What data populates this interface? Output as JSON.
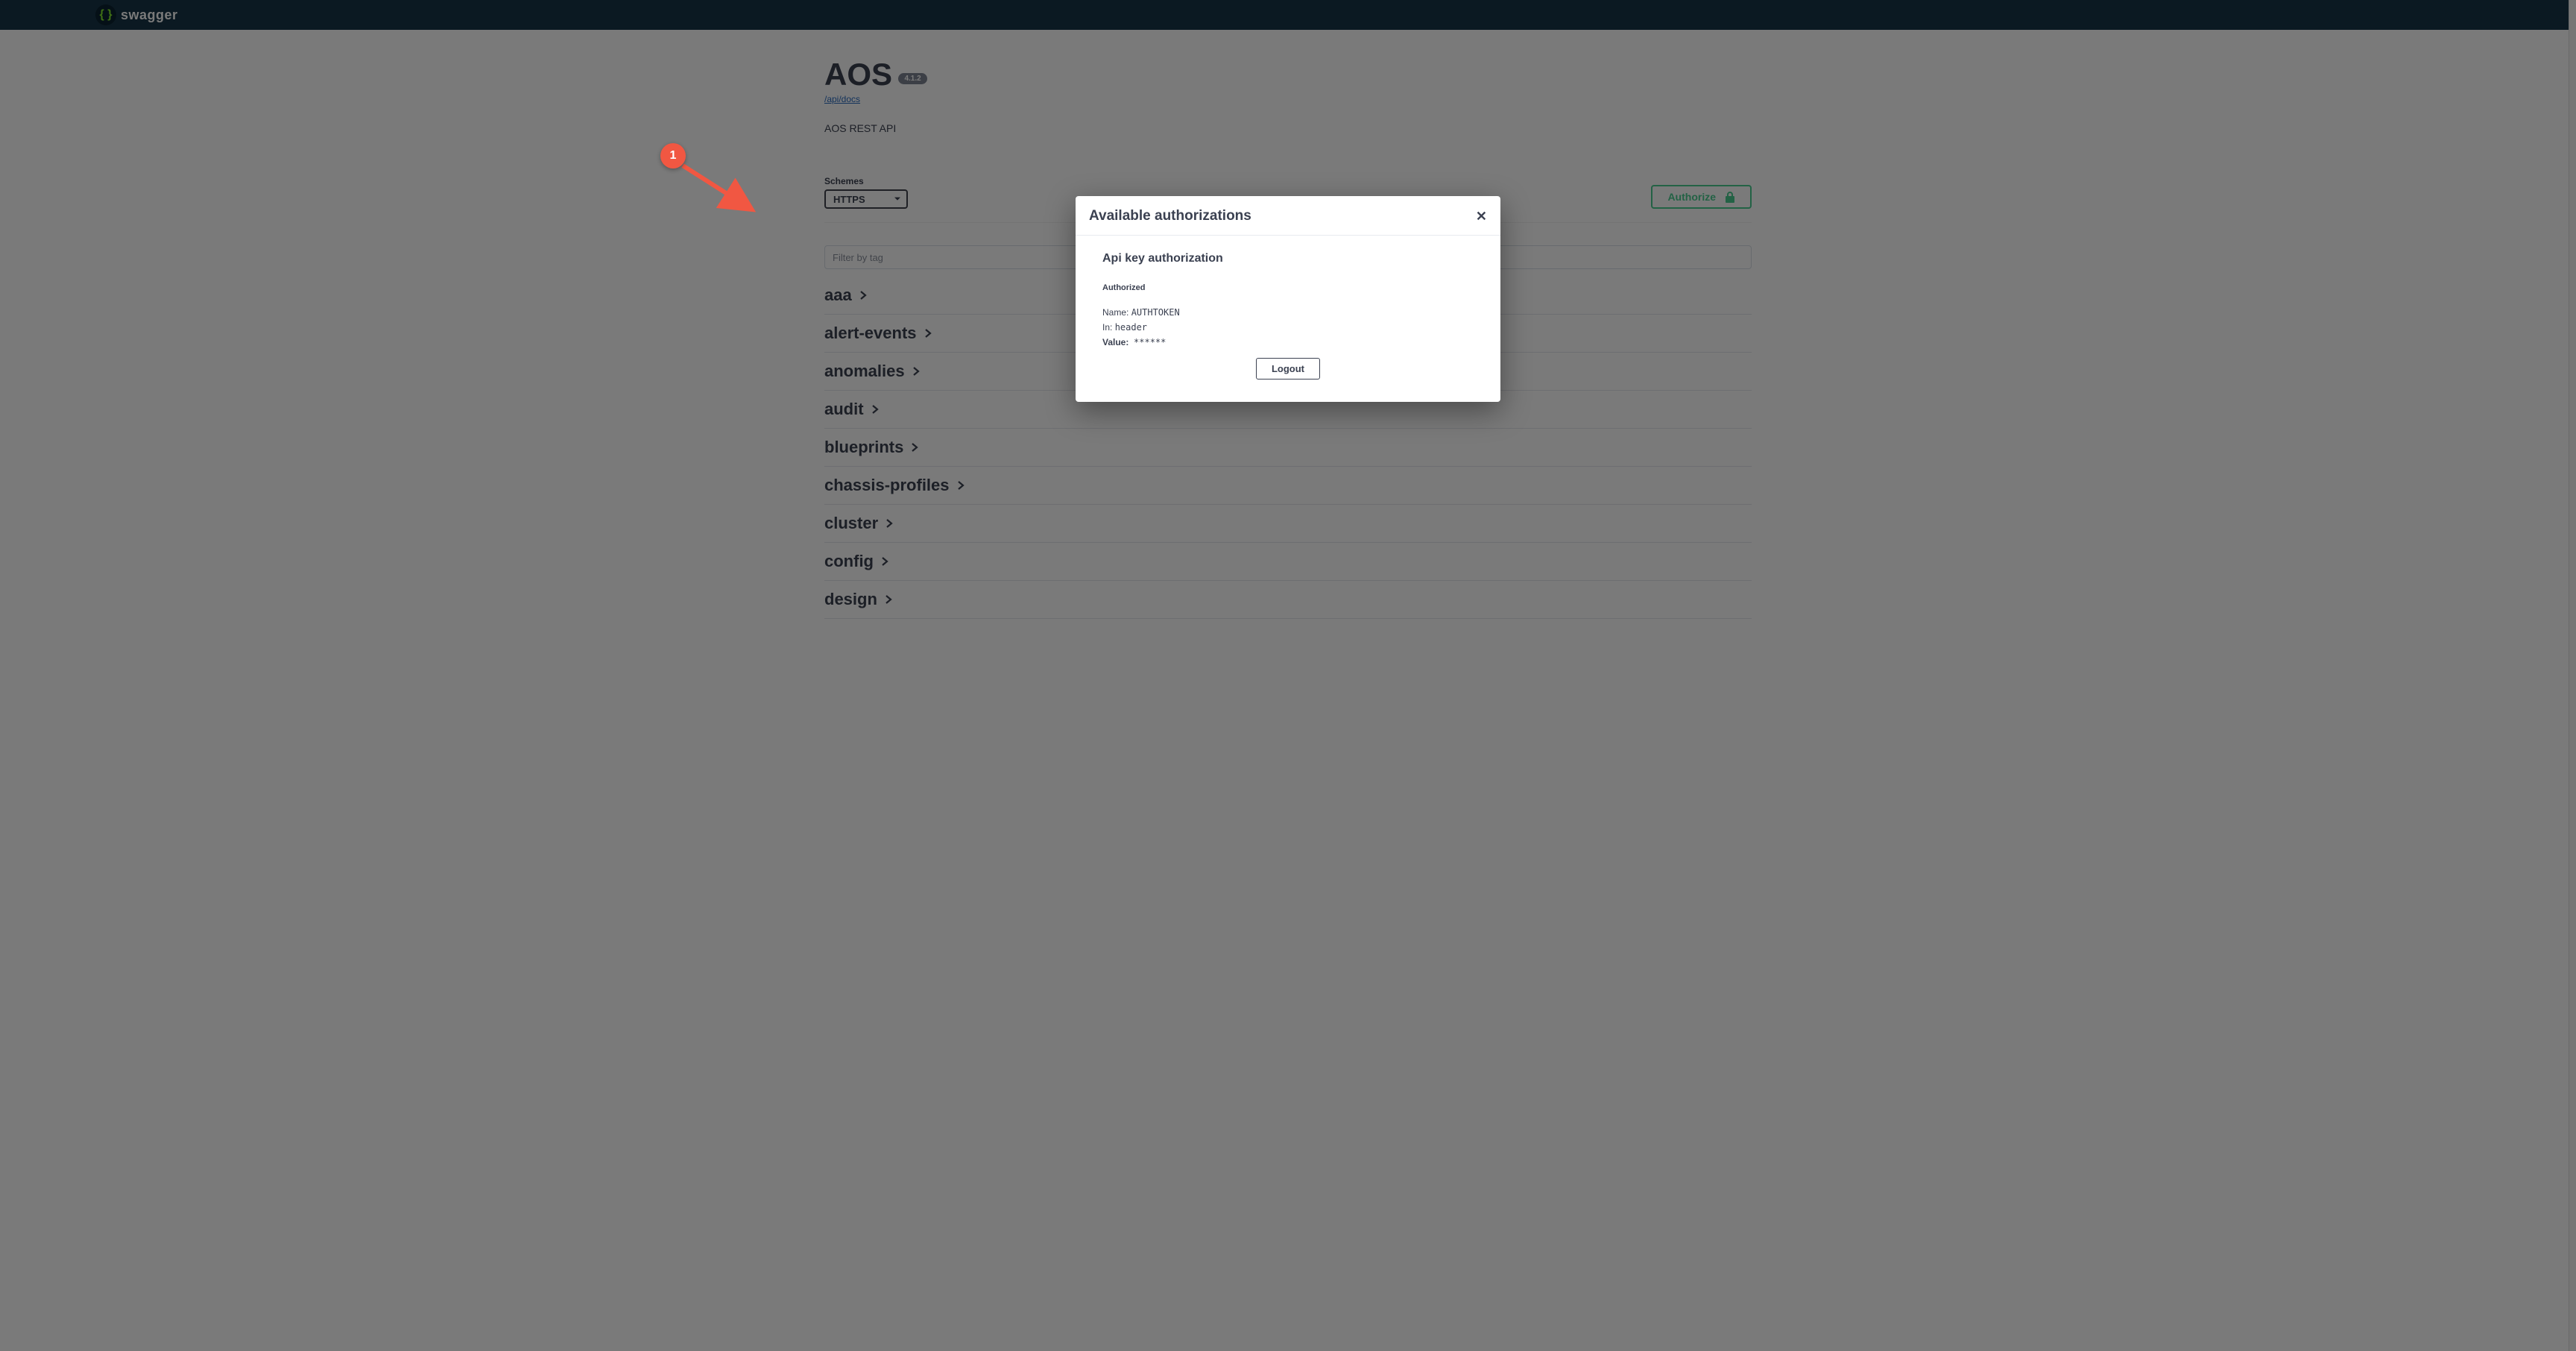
{
  "topbar": {
    "brand": "swagger",
    "logo_glyph": "{ }"
  },
  "info": {
    "title": "AOS",
    "version": "4.1.2",
    "docs_link": "/api/docs",
    "description": "AOS REST API"
  },
  "schemes": {
    "label": "Schemes",
    "selected": "HTTPS"
  },
  "authorize_button": "Authorize",
  "filter": {
    "placeholder": "Filter by tag"
  },
  "tags": [
    "aaa",
    "alert-events",
    "anomalies",
    "audit",
    "blueprints",
    "chassis-profiles",
    "cluster",
    "config",
    "design"
  ],
  "modal": {
    "title": "Available authorizations",
    "auth_heading": "Api key authorization",
    "status": "Authorized",
    "name_label": "Name:",
    "name_value": "AUTHTOKEN",
    "in_label": "In:",
    "in_value": "header",
    "value_label": "Value:",
    "value_masked": "******",
    "logout": "Logout"
  },
  "annotation": {
    "number": "1"
  }
}
